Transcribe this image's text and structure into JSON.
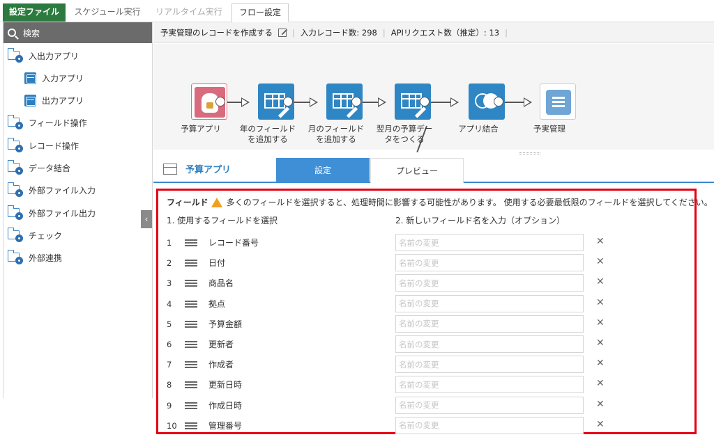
{
  "top_tabs": {
    "brand": "設定ファイル",
    "schedule": "スケジュール実行",
    "realtime": "リアルタイム実行",
    "flow": "フロー設定"
  },
  "sidebar": {
    "search_placeholder": "検索",
    "items": [
      {
        "label": "入出力アプリ"
      },
      {
        "label": "入力アプリ"
      },
      {
        "label": "出力アプリ"
      },
      {
        "label": "フィールド操作"
      },
      {
        "label": "レコード操作"
      },
      {
        "label": "データ結合"
      },
      {
        "label": "外部ファイル入力"
      },
      {
        "label": "外部ファイル出力"
      },
      {
        "label": "チェック"
      },
      {
        "label": "外部連携"
      }
    ]
  },
  "infobar": {
    "flow_name": "予実管理のレコードを作成する",
    "input_records": "入力レコード数: 298",
    "api_requests": "APIリクエスト数（推定）: 13"
  },
  "flow": {
    "nodes": [
      {
        "line1": "予算アプリ",
        "line2": ""
      },
      {
        "line1": "年のフィールド",
        "line2": "を追加する"
      },
      {
        "line1": "月のフィールド",
        "line2": "を追加する"
      },
      {
        "line1": "翌月の予算デー",
        "line2": "タをつくる"
      },
      {
        "line1": "アプリ結合",
        "line2": ""
      },
      {
        "line1": "予実管理",
        "line2": ""
      }
    ]
  },
  "panel": {
    "title": "予算アプリ",
    "tab_settings": "設定",
    "tab_preview": "プレビュー"
  },
  "fields": {
    "label": "フィールド",
    "warning": "多くのフィールドを選択すると、処理時間に影響する可能性があります。 使用する必要最低限のフィールドを選択してください。",
    "col1": "1. 使用するフィールドを選択",
    "col2": "2. 新しいフィールド名を入力（オプション）",
    "placeholder": "名前の変更",
    "rows": [
      {
        "num": "1",
        "name": "レコード番号"
      },
      {
        "num": "2",
        "name": "日付"
      },
      {
        "num": "3",
        "name": "商品名"
      },
      {
        "num": "4",
        "name": "拠点"
      },
      {
        "num": "5",
        "name": "予算金額"
      },
      {
        "num": "6",
        "name": "更新者"
      },
      {
        "num": "7",
        "name": "作成者"
      },
      {
        "num": "8",
        "name": "更新日時"
      },
      {
        "num": "9",
        "name": "作成日時"
      },
      {
        "num": "10",
        "name": "管理番号"
      }
    ]
  },
  "colors": {
    "brand_green": "#2c7a3f",
    "node_blue": "#2f86c4",
    "highlight_red": "#e60012",
    "accent_blue": "#3f8fd6"
  }
}
